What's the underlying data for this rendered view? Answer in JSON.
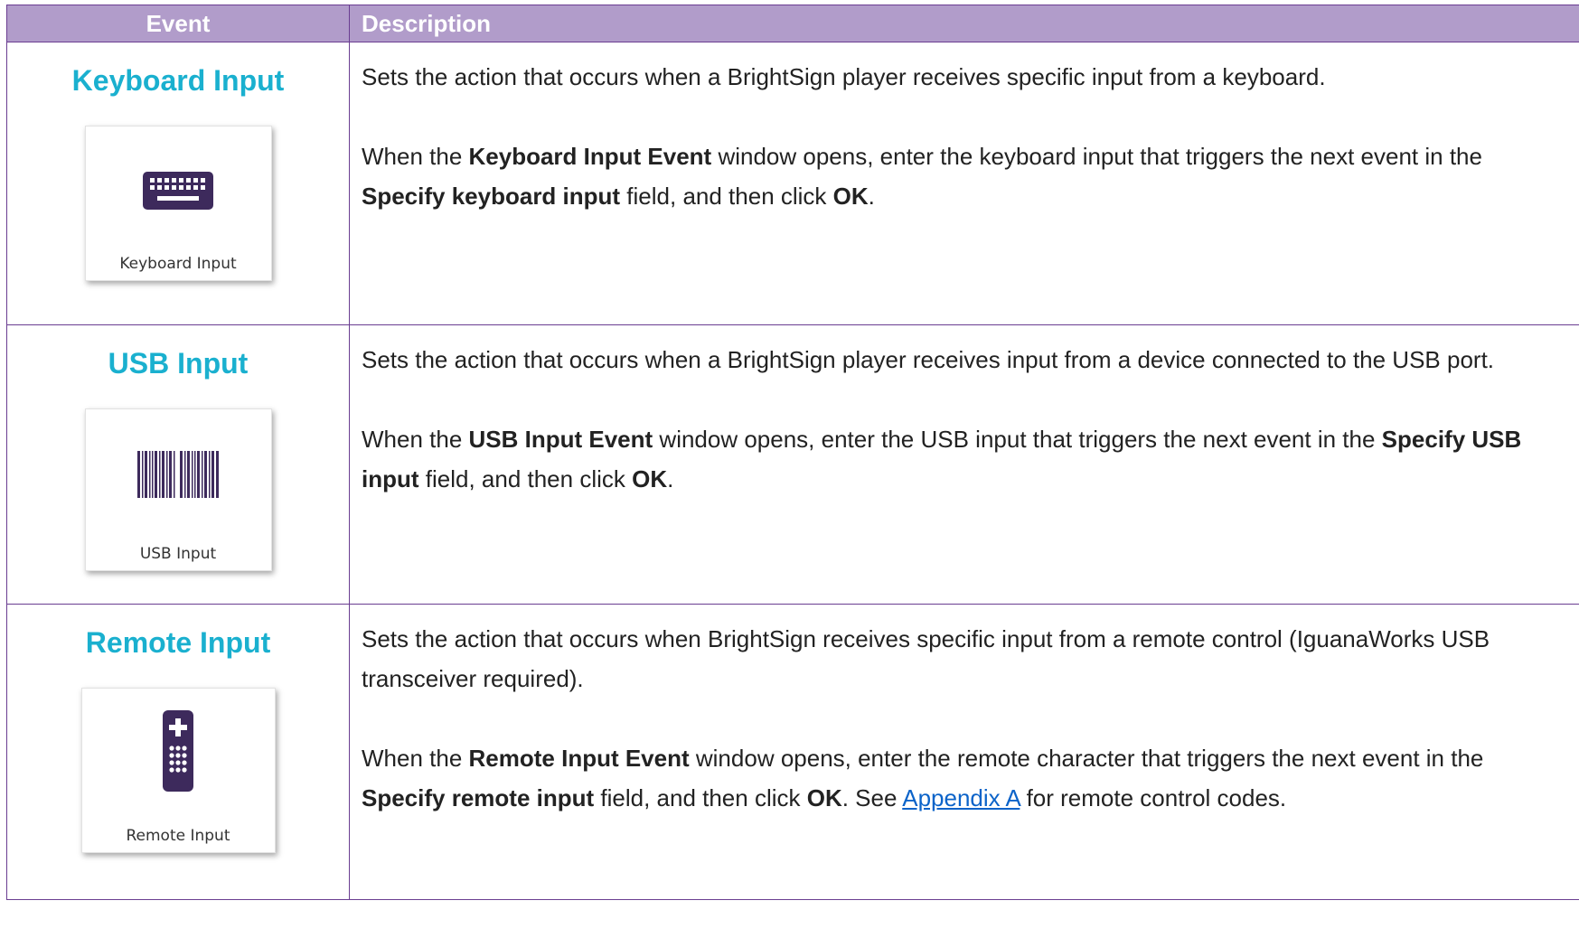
{
  "header": {
    "event": "Event",
    "description": "Description"
  },
  "rows": [
    {
      "title": "Keyboard Input",
      "tile_label": "Keyboard Input",
      "icon": "keyboard-icon",
      "p1": "Sets the action that occurs when a BrightSign player receives specific input from a keyboard.",
      "p2": {
        "t1": "When the ",
        "b1": "Keyboard Input Event",
        "t2": " window opens, enter the keyboard input that triggers the next event in the ",
        "b2": "Specify keyboard input",
        "t3": " field, and then click ",
        "b3": "OK",
        "t4": "."
      }
    },
    {
      "title": "USB Input",
      "tile_label": "USB Input",
      "icon": "barcode-icon",
      "p1": "Sets the action that occurs when a BrightSign player receives input from a device connected to the USB port.",
      "p2": {
        "t1": "When the ",
        "b1": "USB Input Event",
        "t2": " window opens, enter the USB input that triggers the next event in the ",
        "b2": "Specify USB input",
        "t3": " field, and then click ",
        "b3": "OK",
        "t4": "."
      }
    },
    {
      "title": "Remote Input",
      "tile_label": "Remote Input",
      "icon": "remote-control-icon",
      "p1": "Sets the action that occurs when BrightSign receives specific input from a remote control (IguanaWorks USB transceiver required).",
      "p2": {
        "t1": "When the ",
        "b1": "Remote Input Event",
        "t2": " window opens, enter the remote character that triggers the next event in the ",
        "b2": "Specify remote input",
        "t3": " field, and then click ",
        "b3": "OK",
        "t4": ". See ",
        "link": "Appendix A",
        "t5": " for remote control codes."
      }
    }
  ],
  "colors": {
    "header_bg": "#b19cca",
    "border": "#6a3d91",
    "title": "#1ab0cf",
    "icon": "#3d2a5c",
    "link": "#0b63c9"
  }
}
